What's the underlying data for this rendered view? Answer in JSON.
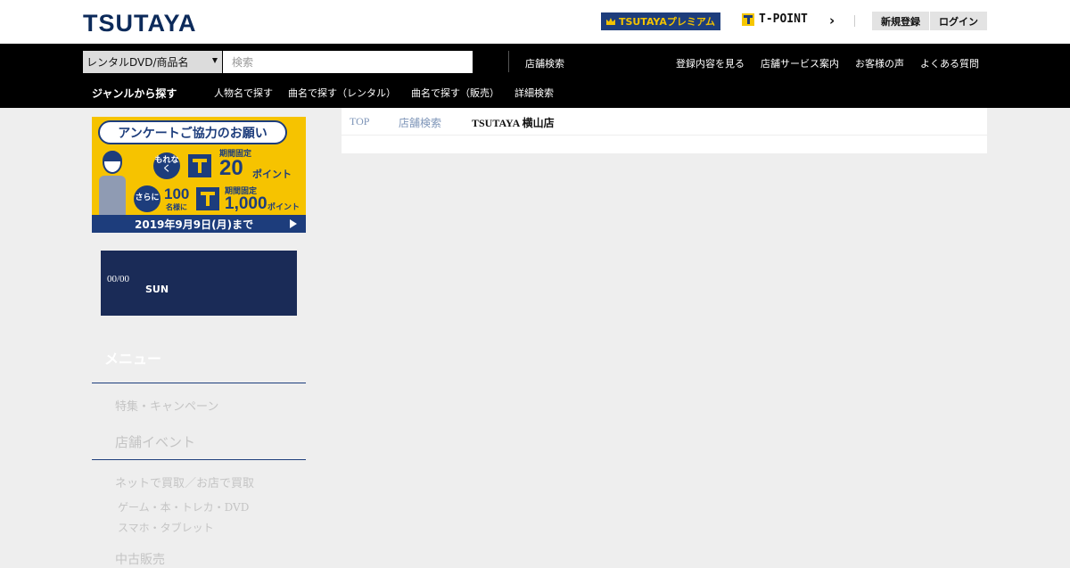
{
  "header": {
    "logo": "TSUTAYA",
    "premium_label": "TSUTAYAプレミアム",
    "tpoint_label": "T-POINT",
    "signup_label": "新規登録",
    "login_label": "ログイン"
  },
  "nav": {
    "category_select": "レンタルDVD/商品名",
    "search_placeholder": "検索",
    "store_search": "店舗検索",
    "links": [
      "登録内容を見る",
      "店舗サービス案内",
      "お客様の声",
      "よくある質問"
    ],
    "genre_label": "ジャンルから探す",
    "sublinks": [
      "人物名で探す",
      "曲名で探す（レンタル）",
      "曲名で探す（販売）",
      "詳細検索"
    ]
  },
  "banner": {
    "title": "アンケートご協力のお願い",
    "tag1": "もれなく",
    "fixed1": "期間固定",
    "points1": "20",
    "unit1": "ポイント",
    "tag2": "さらに",
    "count2": "100",
    "count2_unit": "名様に",
    "fixed2": "期間固定",
    "points2": "1,000",
    "unit2": "ポイント",
    "deadline": "2019年9月9日(月)まで"
  },
  "datebox": {
    "date": "00/00",
    "weekday": "SUN"
  },
  "sidebar": {
    "menu_title": "メニュー",
    "items": [
      "特集・キャンペーン",
      "店舗イベント",
      "ネットで買取／お店で買取",
      "ゲーム・本・トレカ・DVD",
      "スマホ・タブレット",
      "中古販売"
    ]
  },
  "breadcrumb": [
    "TOP",
    "店舗検索",
    "TSUTAYA 横山店"
  ],
  "colors": {
    "brand_navy": "#1d3d7c",
    "accent_yellow": "#f6c300",
    "nav_black": "#000000",
    "page_bg": "#eeeeee"
  }
}
